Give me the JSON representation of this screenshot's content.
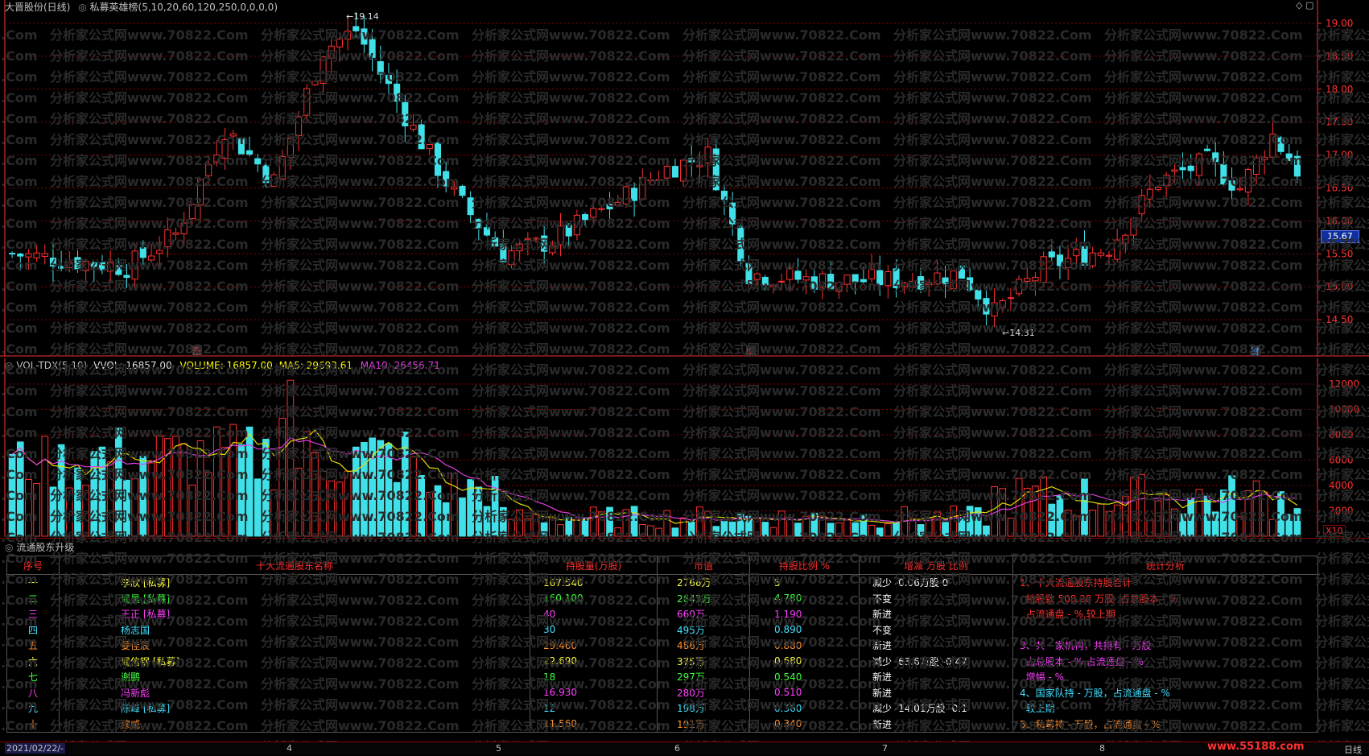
{
  "colors": {
    "up": "#ff3030",
    "down": "#40e0e8",
    "ma5": "#e0e000",
    "ma10": "#e040e0",
    "grid": "#8b0000",
    "axis": "#ff3030"
  },
  "price_panel": {
    "title": "大晋股份(日线)",
    "indicator": "私募英雄榜(5,10,20,60,120,250,0,0,0,0)",
    "high_label": "19.14",
    "low_label": "14.31",
    "current_price": "15.67",
    "markers": [
      "涨",
      "$",
      "财"
    ],
    "y_ticks": [
      "19.00",
      "18.50",
      "18.00",
      "17.50",
      "17.00",
      "16.50",
      "16.00",
      "15.50",
      "15.00",
      "14.50"
    ]
  },
  "volume_panel": {
    "title": "VOL-TDX(5,10)",
    "vvol": "VVOL: 16857.00",
    "volume": "VOLUME: 16857.00",
    "ma5": "MA5: 29693.61",
    "ma10": "MA10: 26456.71",
    "unit": "X10",
    "y_ticks": [
      "12000",
      "10000",
      "8000",
      "6000",
      "4000",
      "2000"
    ]
  },
  "holders_panel": {
    "title": "流通股东升级",
    "headers": [
      "序号",
      "十大流通股东名称",
      "持股量(万股)",
      "市值",
      "持股比例 %",
      "增减 万股 比例",
      "统计分析"
    ],
    "rows": [
      {
        "no": "一",
        "name": "李欣 [私募]",
        "qty": "167.540",
        "value": "2766万",
        "ratio": "5",
        "change": "减少 -0.06万股 0",
        "color": "#ffff40"
      },
      {
        "no": "二",
        "name": "周晨 [私募]",
        "qty": "160.100",
        "value": "2643万",
        "ratio": "4.780",
        "change": "不变",
        "color": "#40ff40"
      },
      {
        "no": "三",
        "name": "王正 [私募]",
        "qty": "40",
        "value": "660万",
        "ratio": "1.190",
        "change": "新进",
        "color": "#ff40ff"
      },
      {
        "no": "四",
        "name": "杨志国",
        "qty": "30",
        "value": "495万",
        "ratio": "0.890",
        "change": "不变",
        "color": "#40e0ff"
      },
      {
        "no": "五",
        "name": "姜佳辰",
        "qty": "29.460",
        "value": "486万",
        "ratio": "0.880",
        "change": "新进",
        "color": "#ff9030"
      },
      {
        "no": "六",
        "name": "周信钢 [私募]",
        "qty": "22.690",
        "value": "375万",
        "ratio": "0.680",
        "change": "减少 -63.6万股 -0.47",
        "color": "#ffff40"
      },
      {
        "no": "七",
        "name": "谢鹏",
        "qty": "18",
        "value": "297万",
        "ratio": "0.540",
        "change": "新进",
        "color": "#40ff40"
      },
      {
        "no": "八",
        "name": "冯新彪",
        "qty": "16.930",
        "value": "280万",
        "ratio": "0.510",
        "change": "新进",
        "color": "#ff40ff"
      },
      {
        "no": "九",
        "name": "陈峰 [私募]",
        "qty": "12",
        "value": "198万",
        "ratio": "0.360",
        "change": "减少 -14.01万股 -0.1",
        "color": "#40e0ff"
      },
      {
        "no": "十",
        "name": "穆威",
        "qty": "11.560",
        "value": "191万",
        "ratio": "0.340",
        "change": "新进",
        "color": "#ff9030"
      }
    ],
    "analysis": [
      {
        "text": "1、十大流通股东持股合计",
        "color": "#ff3030"
      },
      {
        "text": "  持股数 508.28 万股 ,占总股本 - %",
        "color": "#ff3030"
      },
      {
        "text": "  占流通盘 - %,较上期",
        "color": "#ff3030"
      },
      {
        "text": "",
        "color": "#ff3030"
      },
      {
        "text": "3、共 - 家机构，共持有 - 万股",
        "color": "#ff40ff"
      },
      {
        "text": "  占总股本 - %,占流通盘 - %",
        "color": "#ff40ff"
      },
      {
        "text": "  增幅 - %",
        "color": "#ff40ff"
      },
      {
        "text": "4、国家队持 - 万股，占流通盘 - %",
        "color": "#40e0ff"
      },
      {
        "text": "  较上期",
        "color": "#40e0ff"
      },
      {
        "text": "5、私募持 - 万股，占流通盘 - %",
        "color": "#ff9030"
      }
    ]
  },
  "footer": {
    "date": "2021/02/22/-",
    "months": [
      "4",
      "5",
      "6",
      "7",
      "8"
    ],
    "logo": "www.55188.com",
    "corner": "日线"
  },
  "watermark": "分析家公式网www.70822.Com"
}
